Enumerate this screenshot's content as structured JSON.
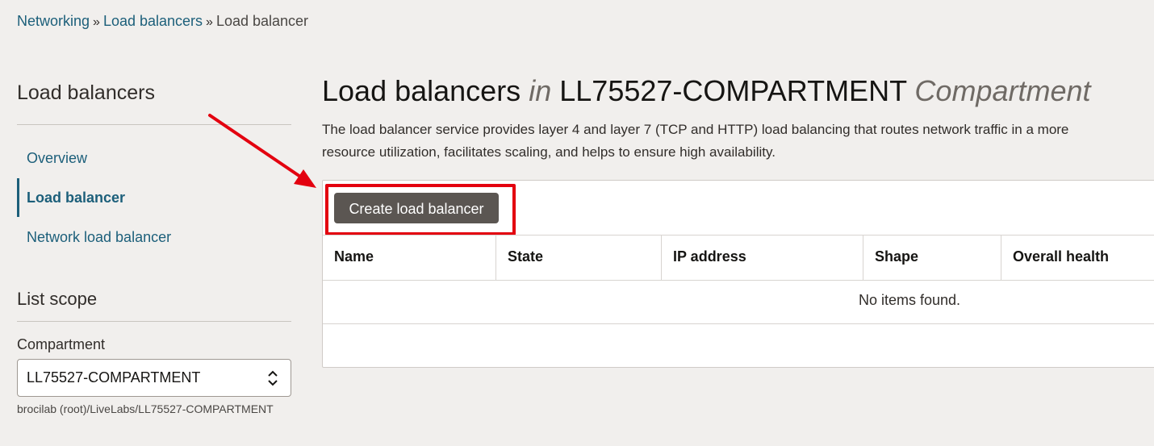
{
  "breadcrumb": {
    "items": [
      "Networking",
      "Load balancers"
    ],
    "current": "Load balancer",
    "separator": "»"
  },
  "sidebar": {
    "heading": "Load balancers",
    "nav": [
      {
        "label": "Overview",
        "active": false
      },
      {
        "label": "Load balancer",
        "active": true
      },
      {
        "label": "Network load balancer",
        "active": false
      }
    ],
    "list_scope": {
      "heading": "List scope",
      "compartment_label": "Compartment",
      "compartment_value": "LL75527-COMPARTMENT",
      "compartment_path": "brocilab (root)/LiveLabs/LL75527-COMPARTMENT"
    }
  },
  "main": {
    "title": {
      "prefix": "Load balancers",
      "in": "in",
      "compartment": "LL75527-COMPARTMENT",
      "suffix": "Compartment"
    },
    "description_lines": [
      "The load balancer service provides layer 4 and layer 7 (TCP and HTTP) load balancing that routes network traffic in a more",
      "resource utilization, facilitates scaling, and helps to ensure high availability."
    ],
    "create_button": "Create load balancer",
    "table": {
      "columns": [
        "Name",
        "State",
        "IP address",
        "Shape",
        "Overall health"
      ],
      "empty_message": "No items found."
    }
  },
  "colors": {
    "link": "#1c5f7a",
    "annotation": "#e3000f",
    "button": "#5b5652"
  },
  "icons": {
    "select_chevron": "up-down-chevron-icon",
    "annotation_arrow": "red-arrow-icon"
  }
}
